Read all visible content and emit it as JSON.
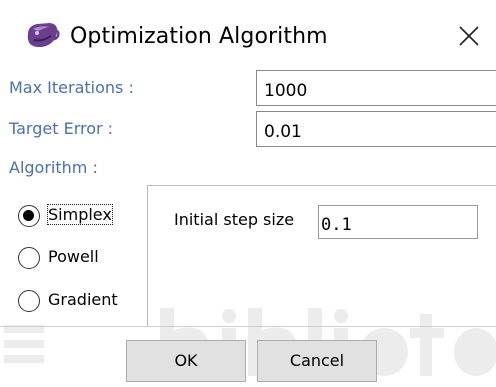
{
  "window": {
    "title": "Optimization Algorithm",
    "app_icon": "java-coffee-cup-icon",
    "close_icon": "close-icon"
  },
  "form": {
    "max_iterations": {
      "label": "Max Iterations :",
      "value": "1000"
    },
    "target_error": {
      "label": "Target Error :",
      "value": "0.01"
    },
    "algorithm": {
      "label": "Algorithm :",
      "options": [
        {
          "label": "Simplex",
          "checked": true
        },
        {
          "label": "Powell",
          "checked": false
        },
        {
          "label": "Gradient",
          "checked": false
        }
      ]
    }
  },
  "panel": {
    "initial_step_size": {
      "label": "Initial step size",
      "value": "0.1"
    }
  },
  "buttons": {
    "ok_label": "OK",
    "cancel_label": "Cancel"
  },
  "colors": {
    "label_blue": "#4a6fb3",
    "button_bg": "#e1e1e1",
    "field_border": "#8a8a8a"
  }
}
